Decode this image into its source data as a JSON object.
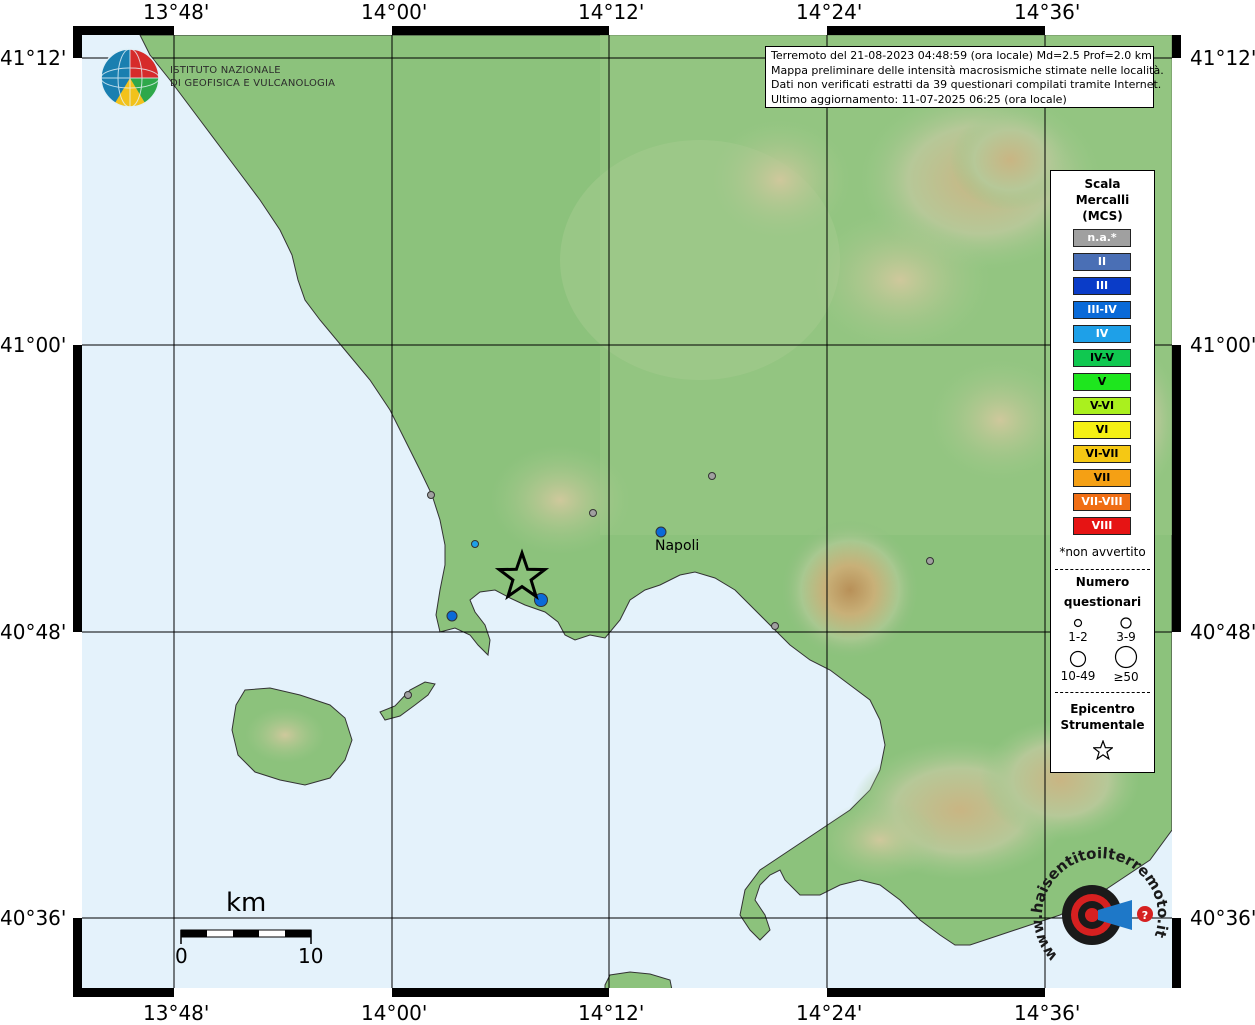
{
  "lon_labels": [
    "13°48'",
    "14°00'",
    "14°12'",
    "14°24'",
    "14°36'"
  ],
  "lat_labels": [
    "41°12'",
    "41°00'",
    "40°48'",
    "40°36'"
  ],
  "info": {
    "line1": "Terremoto del 21-08-2023 04:48:59 (ora locale) Md=2.5 Prof=2.0 km",
    "line2": "Mappa preliminare delle intensità macrosismiche stimate nelle località.",
    "line3": "Dati non verificati estratti da 39 questionari compilati tramite Internet.",
    "line4": "Ultimo aggiornamento: 11-07-2025 06:25 (ora locale)"
  },
  "logo": {
    "line1": "ISTITUTO NAZIONALE",
    "line2": "DI GEOFISICA E VULCANOLOGIA"
  },
  "legend": {
    "title1": "Scala",
    "title2": "Mercalli",
    "title3": "(MCS)",
    "classes": [
      {
        "label": "n.a.*",
        "color": "#a0a0a0",
        "text": "#ffffff"
      },
      {
        "label": "II",
        "color": "#4a6fb5",
        "text": "#ffffff"
      },
      {
        "label": "III",
        "color": "#0a3cc8",
        "text": "#ffffff"
      },
      {
        "label": "III-IV",
        "color": "#0a6ad8",
        "text": "#ffffff"
      },
      {
        "label": "IV",
        "color": "#1ea0e8",
        "text": "#ffffff"
      },
      {
        "label": "IV-V",
        "color": "#10c850",
        "text": "#000000"
      },
      {
        "label": "V",
        "color": "#1ee61e",
        "text": "#000000"
      },
      {
        "label": "V-VI",
        "color": "#aaf01e",
        "text": "#000000"
      },
      {
        "label": "VI",
        "color": "#f5f014",
        "text": "#000000"
      },
      {
        "label": "VI-VII",
        "color": "#f5c814",
        "text": "#000000"
      },
      {
        "label": "VII",
        "color": "#f5a014",
        "text": "#000000"
      },
      {
        "label": "VII-VIII",
        "color": "#f06e14",
        "text": "#ffffff"
      },
      {
        "label": "VIII",
        "color": "#e61414",
        "text": "#ffffff"
      }
    ],
    "not_felt": "*non avvertito",
    "count_title1": "Numero",
    "count_title2": "questionari",
    "count_1": "1-2",
    "count_2": "3-9",
    "count_3": "10-49",
    "count_4": "≥50",
    "epi_title1": "Epicentro",
    "epi_title2": "Strumentale"
  },
  "city": "Napoli",
  "scale_bar": {
    "unit": "km",
    "start": "0",
    "end": "10"
  },
  "watermark": {
    "text": "www.haisentitoilterremoto.it"
  }
}
